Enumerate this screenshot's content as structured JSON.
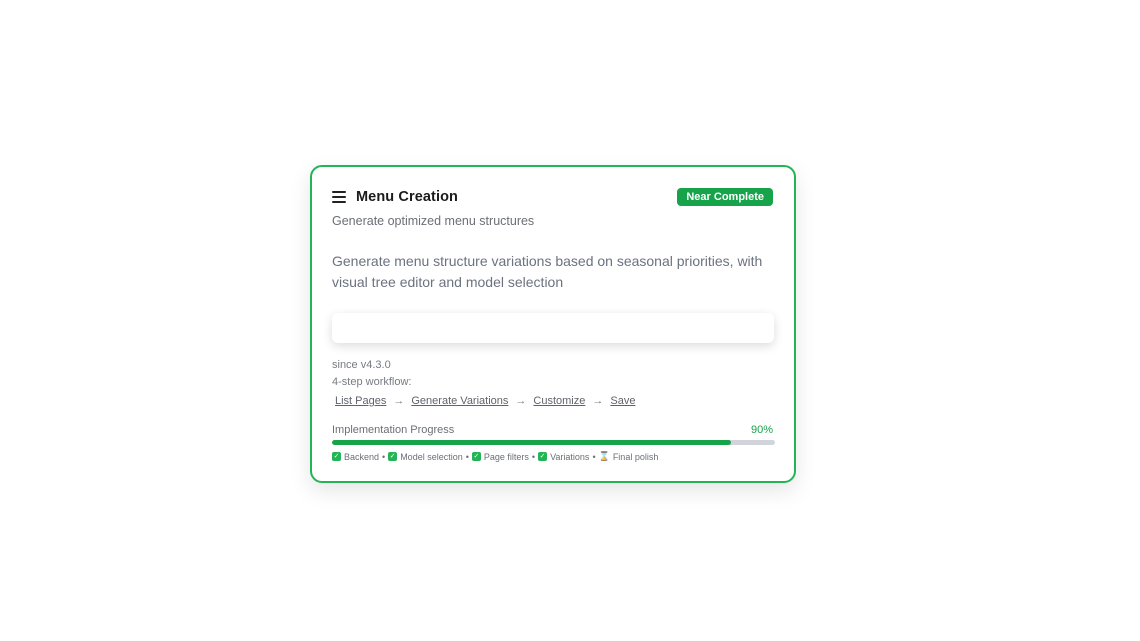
{
  "card": {
    "title": "Menu Creation",
    "badge": "Near Complete",
    "subtitle": "Generate optimized menu structures",
    "description": "Generate menu structure variations based on seasonal priorities, with visual tree editor and model selection",
    "action_button": "",
    "since": "since v4.3.0",
    "workflow_label": "4-step workflow:",
    "steps": [
      "List Pages",
      "Generate Variations",
      "Customize",
      "Save"
    ],
    "progress": {
      "label": "Implementation Progress",
      "percent_text": "90%",
      "value": 0.9
    },
    "checklist": [
      {
        "label": "Backend",
        "status": "done",
        "icon": "check-icon"
      },
      {
        "label": "Model selection",
        "status": "done",
        "icon": "check-icon"
      },
      {
        "label": "Page filters",
        "status": "done",
        "icon": "check-icon"
      },
      {
        "label": "Variations",
        "status": "done",
        "icon": "check-icon"
      },
      {
        "label": "Final polish",
        "status": "pending",
        "icon": "hourglass-icon"
      }
    ],
    "colors": {
      "accent": "#16a34a",
      "border": "#22b455",
      "track": "#d1d5db"
    }
  }
}
